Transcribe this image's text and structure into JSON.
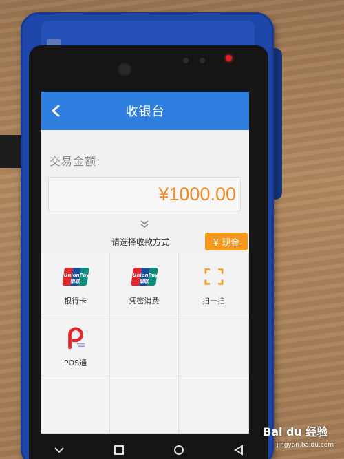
{
  "header": {
    "title": "收银台"
  },
  "amount": {
    "label": "交易金额:",
    "value": "¥1000.00"
  },
  "payment": {
    "prompt": "请选择收款方式",
    "cash_button": "¥ 现金",
    "methods": [
      {
        "label": "银行卡",
        "icon": "unionpay-icon"
      },
      {
        "label": "凭密消费",
        "icon": "unionpay-icon"
      },
      {
        "label": "扫一扫",
        "icon": "scan-icon"
      },
      {
        "label": "POS通",
        "icon": "pos-tong-icon"
      }
    ]
  },
  "unionpay_logo_text": "UnionPay 银联",
  "watermark": {
    "main": "Bai du 经验",
    "sub": "jingyan.baidu.com"
  },
  "colors": {
    "titlebar": "#2f7fe0",
    "accent": "#f39a1e",
    "amount": "#f08a24",
    "device": "#1e46a8"
  }
}
